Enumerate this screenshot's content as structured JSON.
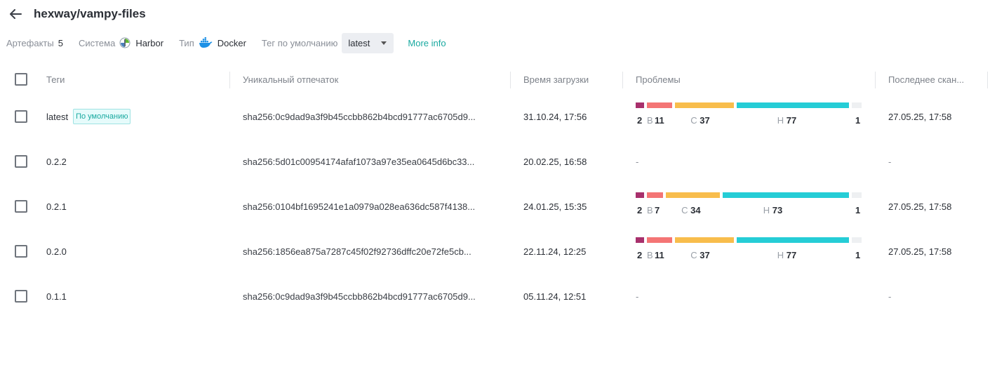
{
  "header": {
    "title": "hexway/vampy-files"
  },
  "meta": {
    "artifacts_label": "Артефакты",
    "artifacts_count": "5",
    "system_label": "Система",
    "system_value": "Harbor",
    "type_label": "Тип",
    "type_value": "Docker",
    "default_tag_label": "Тег по умолчанию",
    "default_tag_value": "latest",
    "more_info": "More info"
  },
  "columns": {
    "tags": "Теги",
    "digest": "Уникальный отпечаток",
    "upload_time": "Время загрузки",
    "issues": "Проблемы",
    "last_scan": "Последнее скан..."
  },
  "colors": {
    "critical": "#a8306c",
    "high": "#f47575",
    "medium": "#f8bd4c",
    "low": "#25cdd6",
    "none": "#eef0f2",
    "accent": "#19a9a0"
  },
  "rows": [
    {
      "tag": "latest",
      "badge": "По умолчанию",
      "digest": "sha256:0c9dad9a3f9b45ccbb862b4bcd91777ac6705d9...",
      "uploaded": "31.10.24, 17:56",
      "issues": {
        "critical": "2",
        "high_label": "В",
        "high": "11",
        "medium_label": "С",
        "medium": "37",
        "low_label": "Н",
        "low": "77",
        "none": "1"
      },
      "scanned": "27.05.25, 17:58"
    },
    {
      "tag": "0.2.2",
      "badge": "",
      "digest": "sha256:5d01c00954174afaf1073a97e35ea0645d6bc33...",
      "uploaded": "20.02.25, 16:58",
      "issues_empty": "-",
      "scanned": "-"
    },
    {
      "tag": "0.2.1",
      "badge": "",
      "digest": "sha256:0104bf1695241e1a0979a028ea636dc587f4138...",
      "uploaded": "24.01.25, 15:35",
      "issues": {
        "critical": "2",
        "high_label": "В",
        "high": "7",
        "medium_label": "С",
        "medium": "34",
        "low_label": "Н",
        "low": "73",
        "none": "1"
      },
      "scanned": "27.05.25, 17:58"
    },
    {
      "tag": "0.2.0",
      "badge": "",
      "digest": "sha256:1856ea875a7287c45f02f92736dffc20e72fe5cb...",
      "uploaded": "22.11.24, 12:25",
      "issues": {
        "critical": "2",
        "high_label": "В",
        "high": "11",
        "medium_label": "С",
        "medium": "37",
        "low_label": "Н",
        "low": "77",
        "none": "1"
      },
      "scanned": "27.05.25, 17:58"
    },
    {
      "tag": "0.1.1",
      "badge": "",
      "digest": "sha256:0c9dad9a3f9b45ccbb862b4bcd91777ac6705d9...",
      "uploaded": "05.11.24, 12:51",
      "issues_empty": "-",
      "scanned": "-"
    }
  ]
}
